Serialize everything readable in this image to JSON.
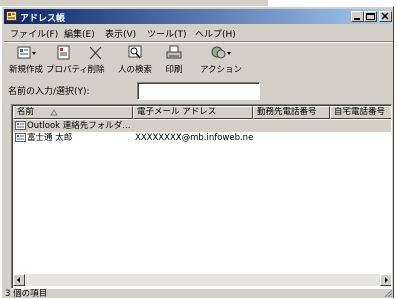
{
  "window": {
    "title": "アドレス帳"
  },
  "menu": [
    "ファイル(F)",
    "編集(E)",
    "表示(V)",
    "ツール(T)",
    "ヘルプ(H)"
  ],
  "toolbar": [
    {
      "label": "新規作成",
      "icon": "new-contact-icon"
    },
    {
      "label": "プロパティ",
      "icon": "properties-icon"
    },
    {
      "label": "削除",
      "icon": "delete-icon"
    },
    {
      "label": "人の検索",
      "icon": "find-people-icon"
    },
    {
      "label": "印刷",
      "icon": "print-icon"
    },
    {
      "label": "アクション",
      "icon": "action-icon"
    }
  ],
  "search": {
    "label": "名前の入力/選択(Y):",
    "value": ""
  },
  "list": {
    "columns": [
      "名前",
      "電子メール アドレス",
      "勤務先電話番号",
      "自宅電話番号"
    ],
    "rows": [
      {
        "name": "Outlook 連絡先フォルダ...",
        "email": "",
        "work_phone": "",
        "home_phone": "",
        "selected": true
      },
      {
        "name": "富士通 太郎",
        "email": "XXXXXXXX@mb.infoweb.ne.jp",
        "work_phone": "",
        "home_phone": "",
        "selected": false
      }
    ]
  },
  "status": {
    "text": "3 個の項目"
  },
  "colors": {
    "titlebar_start": "#0a246a",
    "titlebar_end": "#a6caf0",
    "face": "#d4d0c8"
  }
}
